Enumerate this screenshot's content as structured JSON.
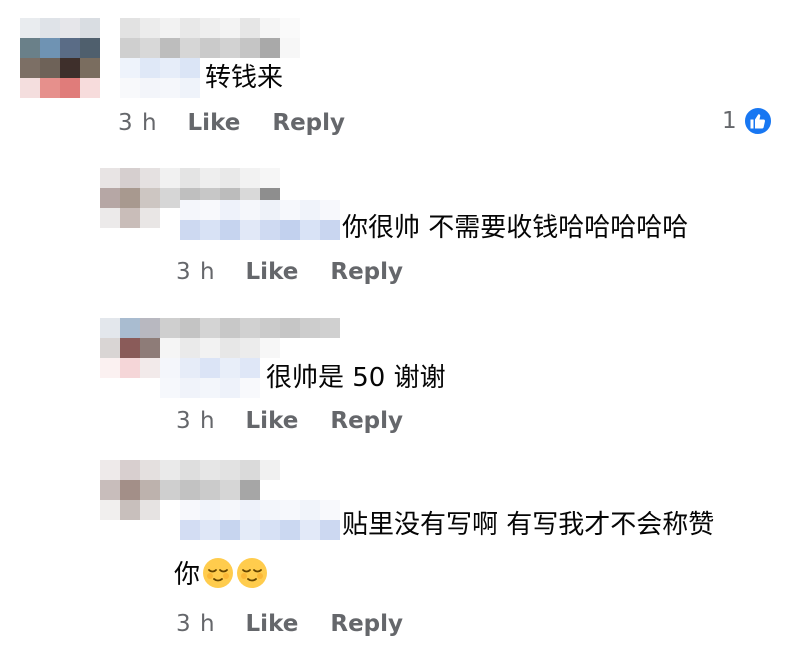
{
  "comments": [
    {
      "text": "转钱来",
      "time": "3 h",
      "like": "Like",
      "reply": "Reply"
    },
    {
      "text": "你很帅 不需要收钱哈哈哈哈哈",
      "time": "3 h",
      "like": "Like",
      "reply": "Reply"
    },
    {
      "text": "很帅是 50 谢谢",
      "time": "3 h",
      "like": "Like",
      "reply": "Reply"
    },
    {
      "text": "贴里没有写啊 有写我才不会称赞",
      "text_cont": "你",
      "time": "3 h",
      "like": "Like",
      "reply": "Reply"
    }
  ],
  "reaction": {
    "count": "1",
    "icon": "thumbs-up-icon",
    "color": "#1877f2"
  },
  "emoji": {
    "name": "relieved-face-emoji",
    "count": 2
  },
  "colors": {
    "meta": "#65676b",
    "text": "#050505"
  }
}
